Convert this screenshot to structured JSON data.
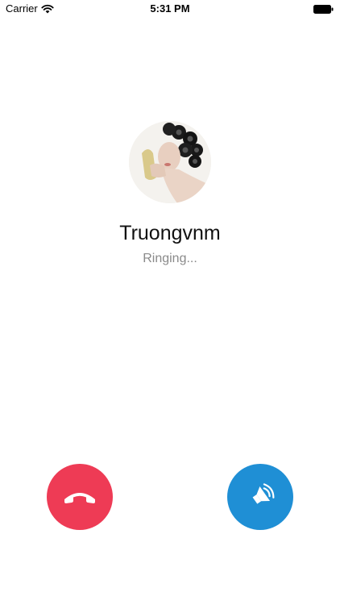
{
  "status_bar": {
    "carrier": "Carrier",
    "time": "5:31 PM"
  },
  "caller": {
    "name": "Truongvnm",
    "status": "Ringing..."
  },
  "buttons": {
    "hangup_icon": "phone-hangup-icon",
    "speaker_icon": "speaker-icon"
  },
  "colors": {
    "hangup": "#ee3b55",
    "speaker": "#1f8fd5",
    "status_text": "#8a8a8a"
  }
}
